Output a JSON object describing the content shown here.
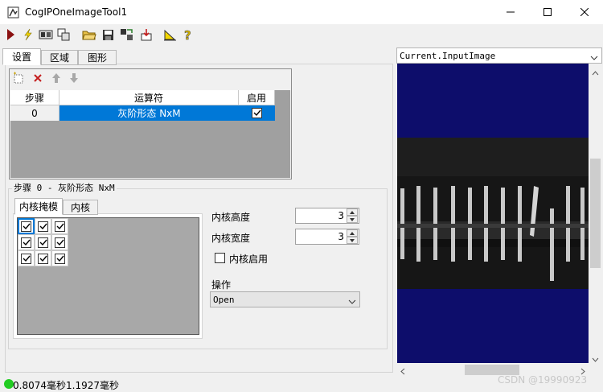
{
  "window": {
    "title": "CogIPOneImageTool1"
  },
  "toolbar": {
    "buttons": [
      "run-icon",
      "flash-icon",
      "image-view-icon",
      "image-view-alt-icon",
      "open-folder-icon",
      "save-icon",
      "tool-settings-icon",
      "import-icon",
      "ruler-icon",
      "help-icon"
    ]
  },
  "tabs": [
    {
      "label": "设置",
      "active": true
    },
    {
      "label": "区域"
    },
    {
      "label": "图形"
    }
  ],
  "ops_table": {
    "headers": [
      "步骤",
      "运算符",
      "启用"
    ],
    "rows": [
      {
        "step": "0",
        "operator": "灰阶形态 NxM",
        "enabled": true
      }
    ]
  },
  "group": {
    "label": "步骤 0 - 灰阶形态 NxM"
  },
  "kernel_tabs": [
    {
      "label": "内核掩模",
      "active": true
    },
    {
      "label": "内核"
    }
  ],
  "kernel_mask": [
    [
      true,
      true,
      true
    ],
    [
      true,
      true,
      true
    ],
    [
      true,
      true,
      true
    ]
  ],
  "fields": {
    "kernel_height": {
      "label": "内核高度",
      "value": "3"
    },
    "kernel_width": {
      "label": "内核宽度",
      "value": "3"
    },
    "kernel_enabled": {
      "label": "内核启用",
      "checked": false
    },
    "operation": {
      "label": "操作",
      "value": "Open"
    }
  },
  "image_panel": {
    "source": "Current.InputImage"
  },
  "status": {
    "text": "0.8074毫秒1.1927毫秒",
    "indicator_color": "#22cc22"
  },
  "watermark": "CSDN @19990923",
  "colors": {
    "selection": "#0078d7",
    "image_bg": "#0d0d6b"
  }
}
